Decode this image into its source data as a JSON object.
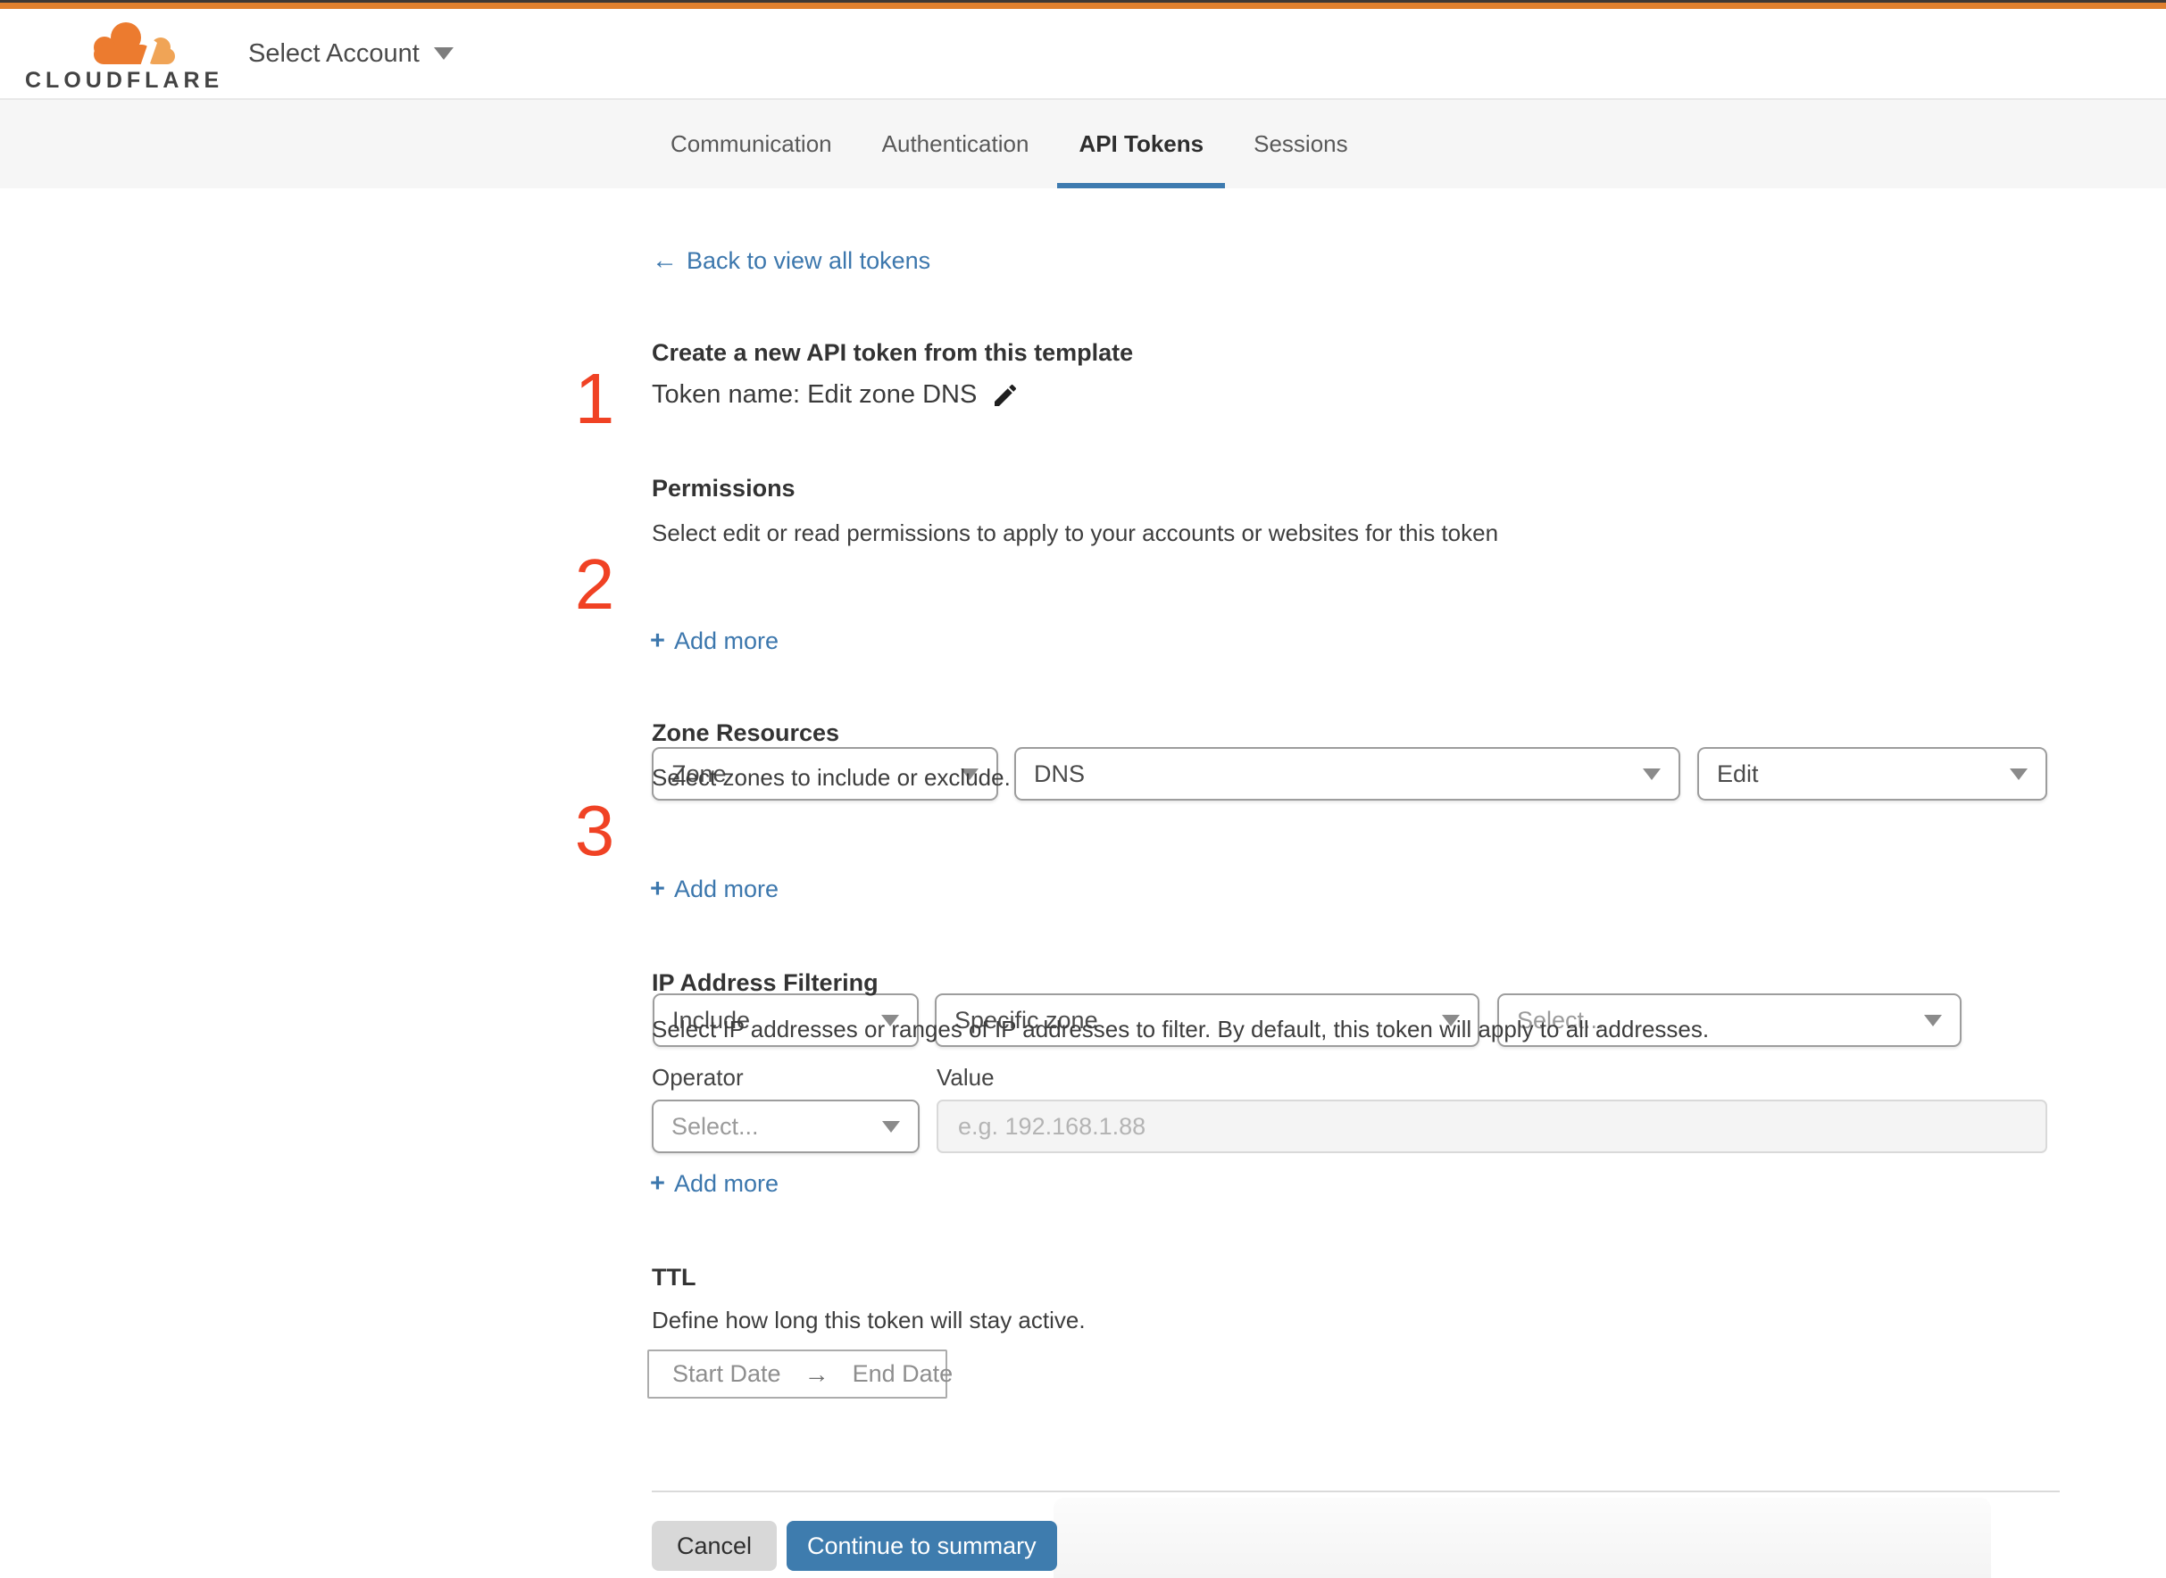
{
  "header": {
    "brand": "CLOUDFLARE",
    "account_selector": "Select Account"
  },
  "tabs": [
    {
      "label": "Communication",
      "active": false
    },
    {
      "label": "Authentication",
      "active": false
    },
    {
      "label": "API Tokens",
      "active": true
    },
    {
      "label": "Sessions",
      "active": false
    }
  ],
  "back_link": {
    "arrow": "←",
    "label": "Back to view all tokens"
  },
  "ui": {
    "plus": "+"
  },
  "step1": {
    "number": "1",
    "title": "Create a new API token from this template",
    "token_name": "Token name: Edit zone DNS"
  },
  "permissions": {
    "number": "2",
    "heading": "Permissions",
    "description": "Select edit or read permissions to apply to your accounts or websites for this token",
    "scope_value": "Zone",
    "type_value": "DNS",
    "access_value": "Edit",
    "add_more_label": "Add more"
  },
  "zone_resources": {
    "number": "3",
    "heading": "Zone Resources",
    "description": "Select zones to include or exclude.",
    "mode_value": "Include",
    "scope_value": "Specific zone",
    "zone_value": "Select...",
    "add_more_label": "Add more"
  },
  "ip_filtering": {
    "heading": "IP Address Filtering",
    "description": "Select IP addresses or ranges of IP addresses to filter. By default, this token will apply to all addresses.",
    "operator_label": "Operator",
    "value_label": "Value",
    "operator_value": "Select...",
    "value_placeholder": "e.g. 192.168.1.88",
    "add_more_label": "Add more"
  },
  "ttl": {
    "heading": "TTL",
    "description": "Define how long this token will stay active.",
    "start_label": "Start Date",
    "range_arrow": "→",
    "end_label": "End Date"
  },
  "footer": {
    "cancel_label": "Cancel",
    "continue_label": "Continue to summary"
  },
  "colors": {
    "accent_blue": "#3c77ad",
    "tab_underline_blue": "#3e7bb0",
    "step_red": "#f04224",
    "brand_orange": "#e0812f",
    "button_blue": "#3e7cae"
  }
}
